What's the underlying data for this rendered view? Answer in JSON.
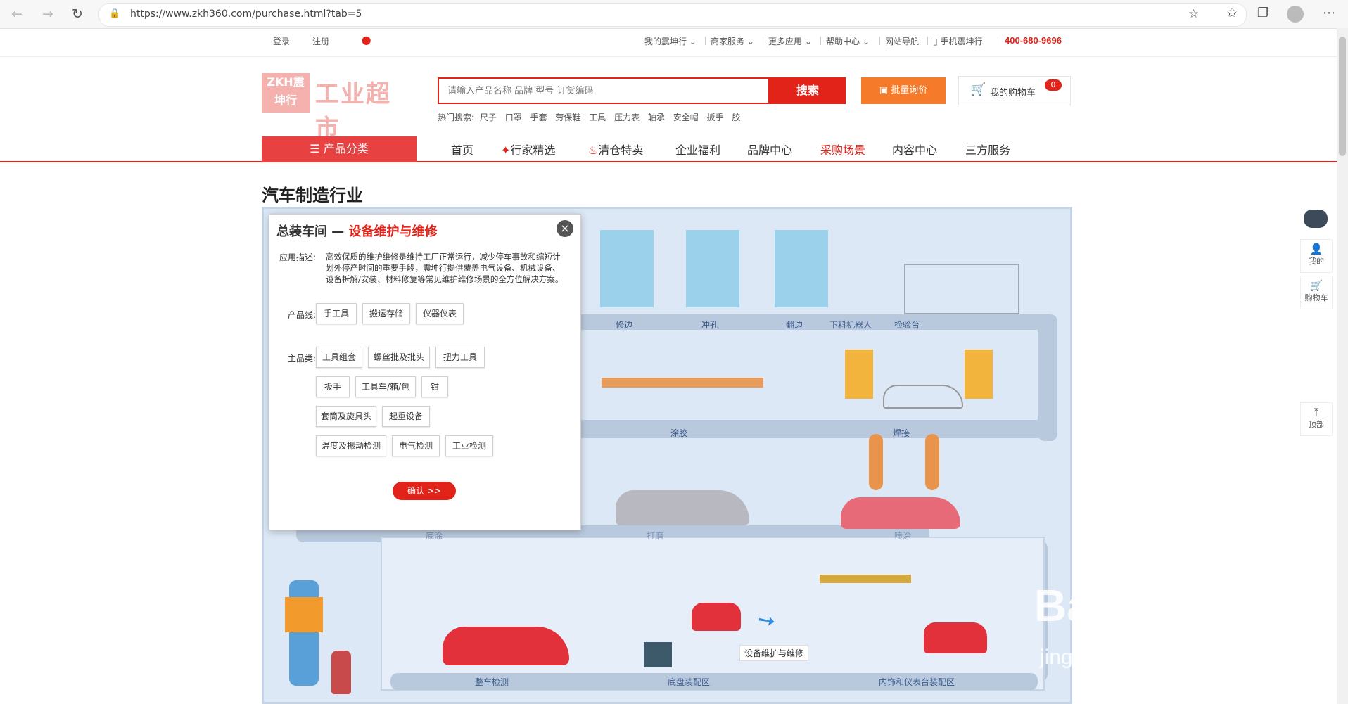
{
  "browser": {
    "url": "https://www.zkh360.com/purchase.html?tab=5"
  },
  "topbar": {
    "login": "登录",
    "register": "注册",
    "my_zkh": "我的震坤行",
    "merchant": "商家服务",
    "more_apps": "更多应用",
    "help": "帮助中心",
    "site_nav": "网站导航",
    "mobile": "手机震坤行",
    "hotline": "400-680-9696"
  },
  "header": {
    "logo_text": "工业超市",
    "logo_box": "ZKH震坤行",
    "search_placeholder": "请输入产品名称 品牌 型号 订货编码",
    "search_button": "搜索",
    "inquiry_button": "批量询价",
    "cart_label": "我的购物车",
    "cart_count": "0",
    "hot_label": "热门搜索:",
    "hot_terms": [
      "尺子",
      "口罩",
      "手套",
      "劳保鞋",
      "工具",
      "压力表",
      "轴承",
      "安全帽",
      "扳手",
      "胶"
    ]
  },
  "nav": {
    "category": "产品分类",
    "items": [
      "首页",
      "行家精选",
      "清仓特卖",
      "企业福利",
      "品牌中心",
      "采购场景",
      "内容中心",
      "三方服务"
    ],
    "active_index": 5
  },
  "page": {
    "title": "汽车制造行业"
  },
  "scene": {
    "stations_top": [
      "修边",
      "冲孔",
      "翻边",
      "下料机器人",
      "检验台"
    ],
    "stations_mid": [
      "涂胶",
      "焊接"
    ],
    "stations_lower": [
      "底涂",
      "打磨",
      "喷涂"
    ],
    "stations_bottom": [
      "整车检测",
      "底盘装配区",
      "内饰和仪表台装配区"
    ],
    "hotspot": "设备维护与维修"
  },
  "popup": {
    "title_prefix": "总装车间 — ",
    "title_highlight": "设备维护与维修",
    "desc_label": "应用描述:",
    "description": "高效保质的维护维修是维持工厂正常运行，减少停车事故和缩短计划外停产时间的重要手段，震坤行提供覆盖电气设备、机械设备、设备拆解/安装、材料修复等常见维护维修场景的全方位解决方案。",
    "line_label": "产品线:",
    "product_lines": [
      "手工具",
      "搬运存储",
      "仪器仪表"
    ],
    "main_label": "主品类:",
    "main_categories": [
      "工具组套",
      "螺丝批及批头",
      "扭力工具",
      "扳手",
      "工具车/箱/包",
      "钳",
      "套筒及旋具头",
      "起重设备",
      "温度及振动检测",
      "电气检测",
      "工业检测"
    ],
    "confirm": "确认 >>"
  },
  "sidebar": {
    "mine": "我的",
    "cart": "购物车",
    "top": "顶部"
  },
  "watermark": {
    "brand": "Baidu经验",
    "url": "jingyan.baidu.com"
  }
}
